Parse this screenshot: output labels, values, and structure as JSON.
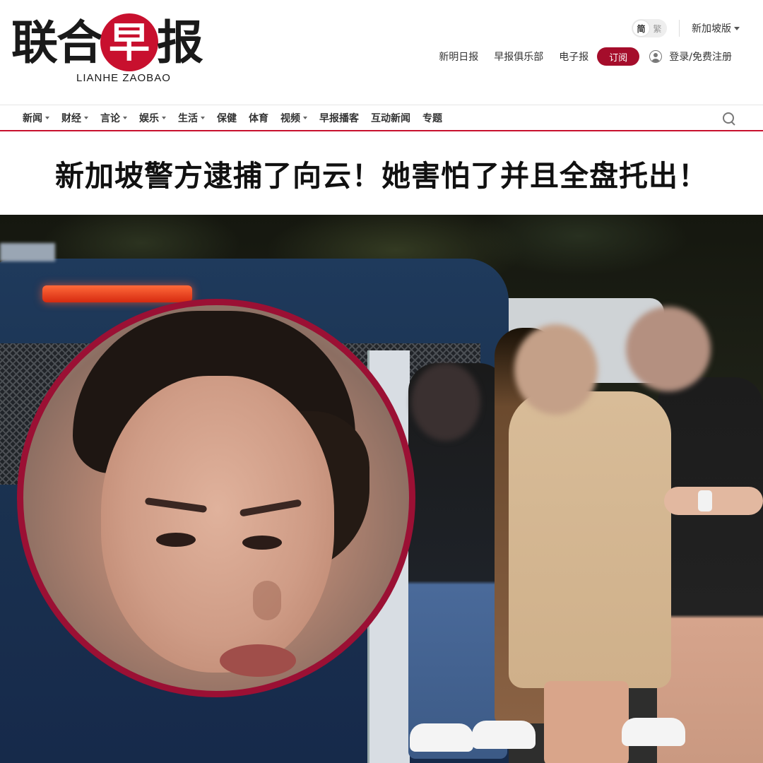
{
  "header": {
    "logo": {
      "chars": [
        "联",
        "合",
        "早",
        "报"
      ],
      "subtitle": "LIANHE ZAOBAO"
    },
    "language_toggle": {
      "simplified": "简",
      "traditional": "繁",
      "active": "simplified"
    },
    "edition": "新加坡版",
    "links": [
      "新明日报",
      "早报俱乐部",
      "电子报"
    ],
    "subscribe_label": "订阅",
    "login_label": "登录/免费注册",
    "brand_color": "#c8102e",
    "subscribe_color": "#a50d2b"
  },
  "nav": {
    "items": [
      {
        "label": "新闻",
        "dropdown": true
      },
      {
        "label": "财经",
        "dropdown": true
      },
      {
        "label": "言论",
        "dropdown": true
      },
      {
        "label": "娱乐",
        "dropdown": true
      },
      {
        "label": "生活",
        "dropdown": true
      },
      {
        "label": "保健",
        "dropdown": false
      },
      {
        "label": "体育",
        "dropdown": false
      },
      {
        "label": "视频",
        "dropdown": true
      },
      {
        "label": "早报播客",
        "dropdown": false
      },
      {
        "label": "互动新闻",
        "dropdown": false
      },
      {
        "label": "专题",
        "dropdown": false
      }
    ],
    "search_icon": "search-icon"
  },
  "article": {
    "headline": "新加坡警方逮捕了向云！她害怕了并且全盘托出！"
  },
  "photo": {
    "inset_border_color": "#9b1034"
  }
}
